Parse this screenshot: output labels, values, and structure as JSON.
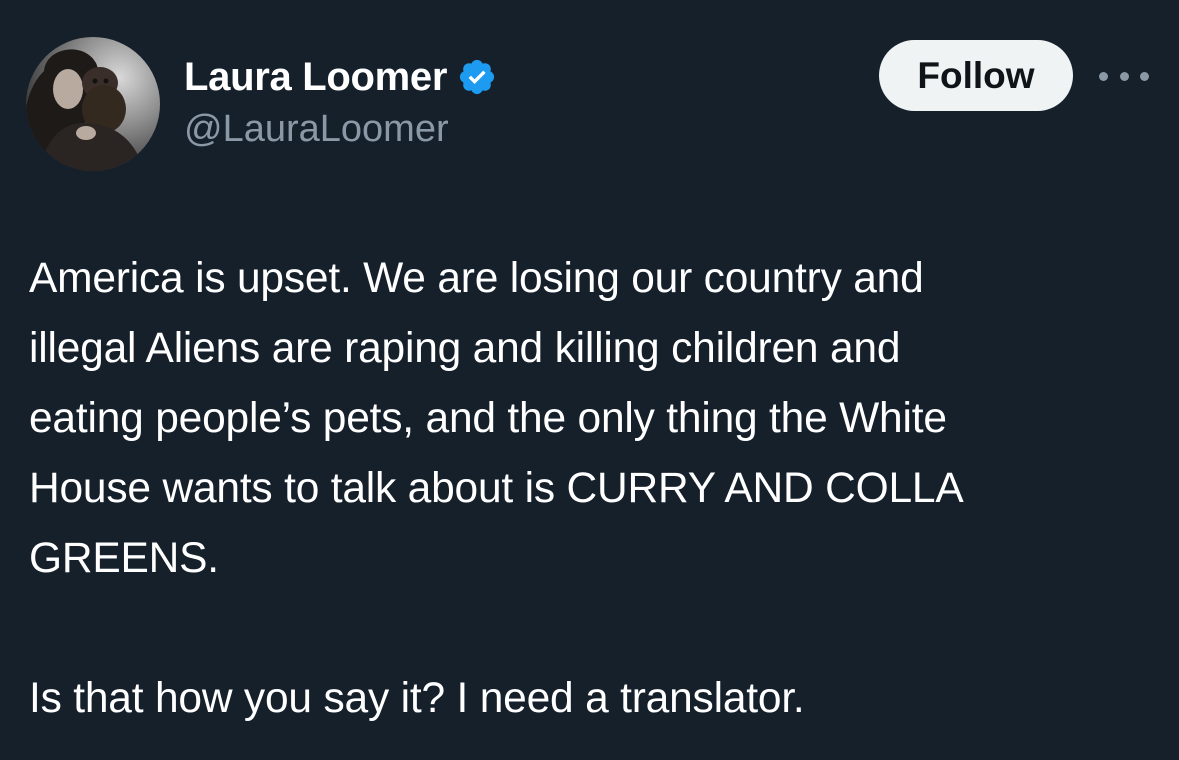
{
  "author": {
    "display_name": "Laura Loomer",
    "handle": "@LauraLoomer",
    "verified": true,
    "verified_icon": "verified-badge-icon",
    "avatar_icon": "profile-photo"
  },
  "actions": {
    "follow_label": "Follow",
    "more_icon": "more-options-icon"
  },
  "tweet": {
    "paragraph_1": "America is upset. We are losing our country and\nillegal Aliens are raping and killing children and\neating people’s pets, and the only thing the White\nHouse wants to talk about is CURRY AND COLLA\nGREENS.",
    "paragraph_2": "Is that how you say it? I need a translator."
  },
  "colors": {
    "background": "#15202b",
    "text_primary": "#ffffff",
    "text_secondary": "#8b98a5",
    "verified_blue": "#1d9bf0",
    "follow_button_bg": "#eff3f4",
    "follow_button_text": "#0f1419"
  }
}
